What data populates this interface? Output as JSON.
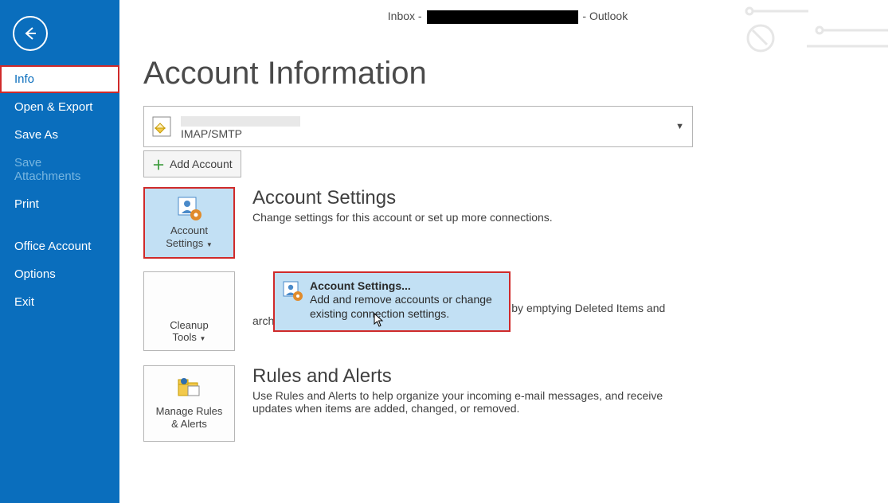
{
  "titlebar": {
    "prefix": "Inbox - ",
    "suffix": " - Outlook"
  },
  "sidebar": {
    "items": [
      {
        "label": "Info",
        "state": "selected"
      },
      {
        "label": "Open & Export",
        "state": ""
      },
      {
        "label": "Save As",
        "state": ""
      },
      {
        "label": "Save Attachments",
        "state": "disabled"
      },
      {
        "label": "Print",
        "state": ""
      },
      {
        "label": "Office Account",
        "state": ""
      },
      {
        "label": "Options",
        "state": ""
      },
      {
        "label": "Exit",
        "state": ""
      }
    ]
  },
  "page": {
    "title": "Account Information"
  },
  "account": {
    "protocol": "IMAP/SMTP",
    "add_label": "Add Account"
  },
  "sections": {
    "account_settings": {
      "btn_line1": "Account",
      "btn_line2": "Settings",
      "heading": "Account Settings",
      "desc": "Change settings for this account or set up more connections."
    },
    "mailbox": {
      "btn_line1": "Cleanup",
      "btn_line2": "Tools",
      "desc_trail": "box by emptying Deleted Items and archiving."
    },
    "rules": {
      "btn_line1": "Manage Rules",
      "btn_line2": "& Alerts",
      "heading": "Rules and Alerts",
      "desc": "Use Rules and Alerts to help organize your incoming e-mail messages, and receive updates when items are added, changed, or removed."
    }
  },
  "popup": {
    "title": "Account Settings...",
    "desc": "Add and remove accounts or change existing connection settings."
  }
}
